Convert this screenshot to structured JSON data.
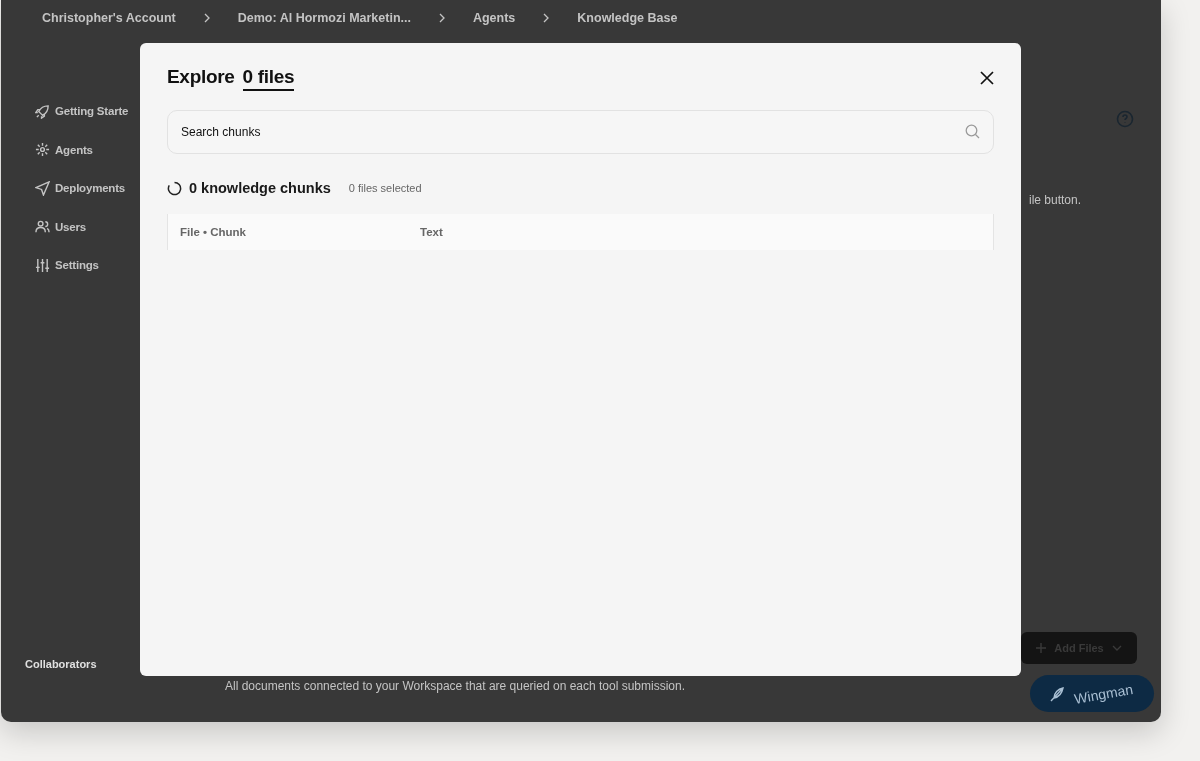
{
  "breadcrumbs": [
    "Christopher's Account",
    "Demo: Al Hormozi Marketin...",
    "Agents",
    "Knowledge Base"
  ],
  "sidebar": {
    "items": [
      {
        "label": "Getting Starte"
      },
      {
        "label": "Agents"
      },
      {
        "label": "Deployments"
      },
      {
        "label": "Users"
      },
      {
        "label": "Settings"
      }
    ],
    "footer": "Collaborators"
  },
  "main": {
    "hint_fragment": "ile button.",
    "add_files_button": "Add Files",
    "description": "All documents connected to your Workspace that are queried on each tool submission.",
    "assistant_button": "Wingman"
  },
  "dialog": {
    "title": "Explore",
    "file_count": "0 files",
    "search": {
      "placeholder": "Search chunks"
    },
    "chunk_count": "0 knowledge chunks",
    "selection": "0 files selected",
    "table": {
      "columns": [
        "File • Chunk",
        "Text"
      ]
    }
  }
}
